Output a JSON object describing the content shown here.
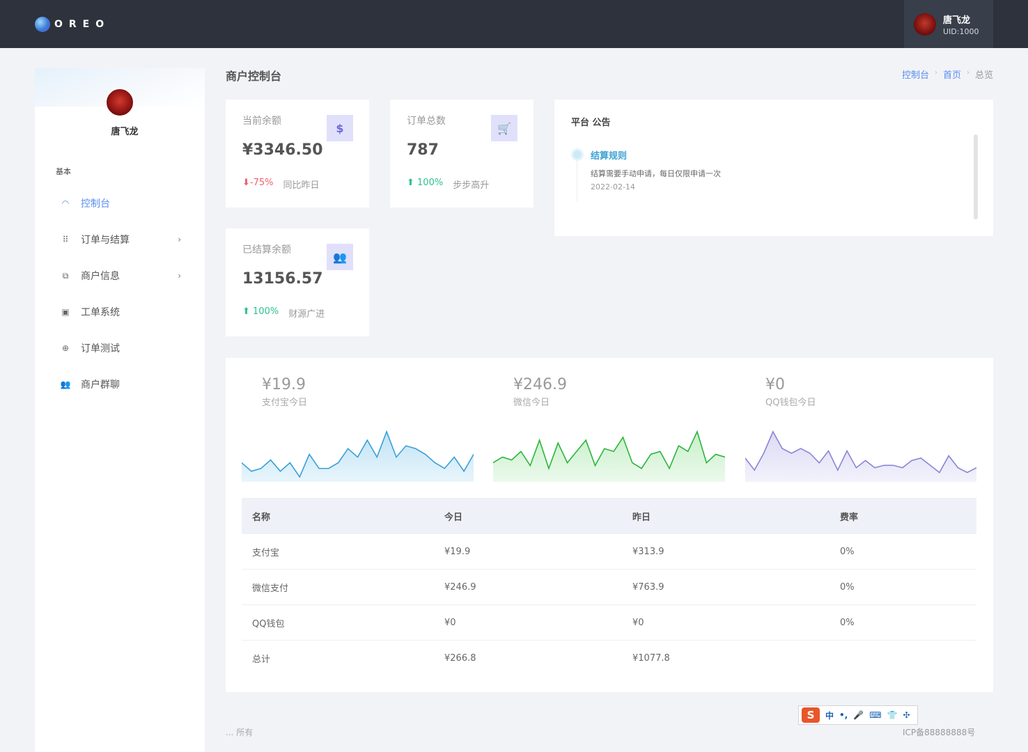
{
  "topbar": {
    "logo_text": "OREO",
    "user_name": "唐飞龙",
    "user_uid": "UID:1000"
  },
  "sidebar": {
    "user_name": "唐飞龙",
    "section_label": "基本",
    "items": [
      {
        "label": "控制台",
        "icon": "dashboard-icon",
        "active": true
      },
      {
        "label": "订单与结算",
        "icon": "grid-icon",
        "has_arrow": true
      },
      {
        "label": "商户信息",
        "icon": "copy-icon",
        "has_arrow": true
      },
      {
        "label": "工单系统",
        "icon": "ticket-icon"
      },
      {
        "label": "订单测试",
        "icon": "test-icon"
      },
      {
        "label": "商户群聊",
        "icon": "group-icon"
      }
    ]
  },
  "header": {
    "title": "商户控制台",
    "breadcrumb": [
      "控制台",
      "首页",
      "总览"
    ]
  },
  "stats": {
    "balance": {
      "label": "当前余额",
      "value": "¥3346.50",
      "icon_text": "$",
      "trend": "-75%",
      "trend_note": "同比昨日"
    },
    "orders": {
      "label": "订单总数",
      "value": "787",
      "icon_text": "🛒",
      "trend": "100%",
      "trend_note": "步步高升"
    },
    "settled": {
      "label": "已结算余额",
      "value": "13156.57",
      "icon_text": "👥",
      "trend": "100%",
      "trend_note": "财源广进"
    }
  },
  "notice": {
    "title": "平台 公告",
    "item_title": "结算规则",
    "item_body": "结算需要手动申请，每日仅限申请一次",
    "item_date": "2022-02-14"
  },
  "sparks": [
    {
      "amount": "¥19.9",
      "label": "支付宝今日",
      "color": "#3aa0d8",
      "fill": "#bfe3f5",
      "values": [
        6,
        3,
        4,
        7,
        3,
        6,
        1,
        9,
        4,
        4,
        6,
        11,
        8,
        14,
        8,
        17,
        8,
        12,
        11,
        9,
        6,
        4,
        8,
        3,
        9
      ]
    },
    {
      "amount": "¥246.9",
      "label": "微信今日",
      "color": "#2bb53b",
      "fill": "#c7efc9",
      "values": [
        6,
        8,
        7,
        10,
        5,
        14,
        4,
        13,
        6,
        10,
        14,
        5,
        11,
        10,
        15,
        6,
        4,
        9,
        10,
        4,
        12,
        10,
        17,
        6,
        9,
        8
      ]
    },
    {
      "amount": "¥0",
      "label": "QQ钱包今日",
      "color": "#8a84d6",
      "fill": "#dcdaf4",
      "values": [
        9,
        4,
        11,
        20,
        13,
        11,
        13,
        11,
        7,
        12,
        4,
        12,
        5,
        8,
        5,
        6,
        6,
        5,
        8,
        9,
        6,
        3,
        10,
        5,
        3,
        5
      ]
    }
  ],
  "table": {
    "headers": [
      "名称",
      "今日",
      "昨日",
      "费率"
    ],
    "rows": [
      [
        "支付宝",
        "¥19.9",
        "¥313.9",
        "0%"
      ],
      [
        "微信支付",
        "¥246.9",
        "¥763.9",
        "0%"
      ],
      [
        "QQ钱包",
        "¥0",
        "¥0",
        "0%"
      ],
      [
        "总计",
        "¥266.8",
        "¥1077.8",
        ""
      ]
    ]
  },
  "footer": {
    "left_text": "... 所有",
    "icp": "ICP备88888888号",
    "ime_items": [
      "中",
      "•,",
      "🎤",
      "⌨",
      "👕",
      "✣"
    ]
  }
}
